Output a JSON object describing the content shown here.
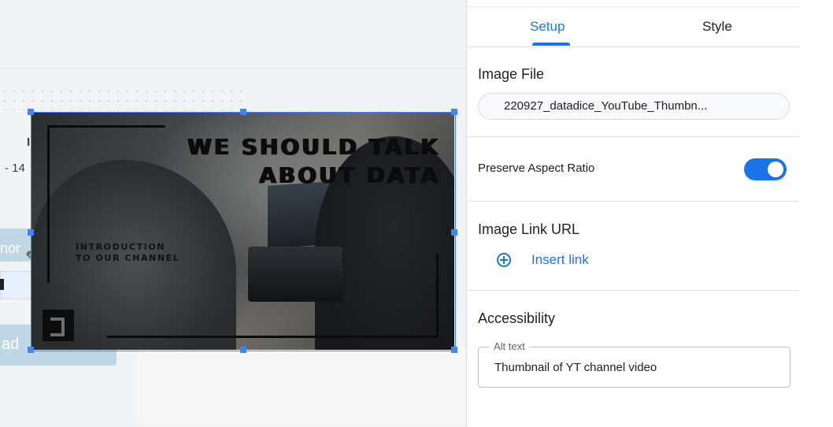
{
  "canvas": {
    "fragments": {
      "bullet": "I",
      "date_range": "- 14",
      "left_text": "nor",
      "bottom_text": "ad"
    },
    "image": {
      "title_line1": "WE SHOULD TALK",
      "title_line2": "ABOUT DATA",
      "subtitle_line1": "INTRODUCTION",
      "subtitle_line2": "TO OUR CHANNEL"
    }
  },
  "panel": {
    "tabs": [
      {
        "label": "Setup",
        "active": true
      },
      {
        "label": "Style",
        "active": false
      }
    ],
    "image_file": {
      "title": "Image File",
      "value": "220927_datadice_YouTube_Thumbn..."
    },
    "preserve_aspect_ratio": {
      "label": "Preserve Aspect Ratio",
      "enabled": true
    },
    "image_link": {
      "title": "Image Link URL",
      "insert_label": "Insert link"
    },
    "accessibility": {
      "title": "Accessibility",
      "alt_label": "Alt text",
      "alt_value": "Thumbnail of YT channel video"
    }
  },
  "colors": {
    "accent": "#1a73e8",
    "selection": "#4285f4"
  }
}
